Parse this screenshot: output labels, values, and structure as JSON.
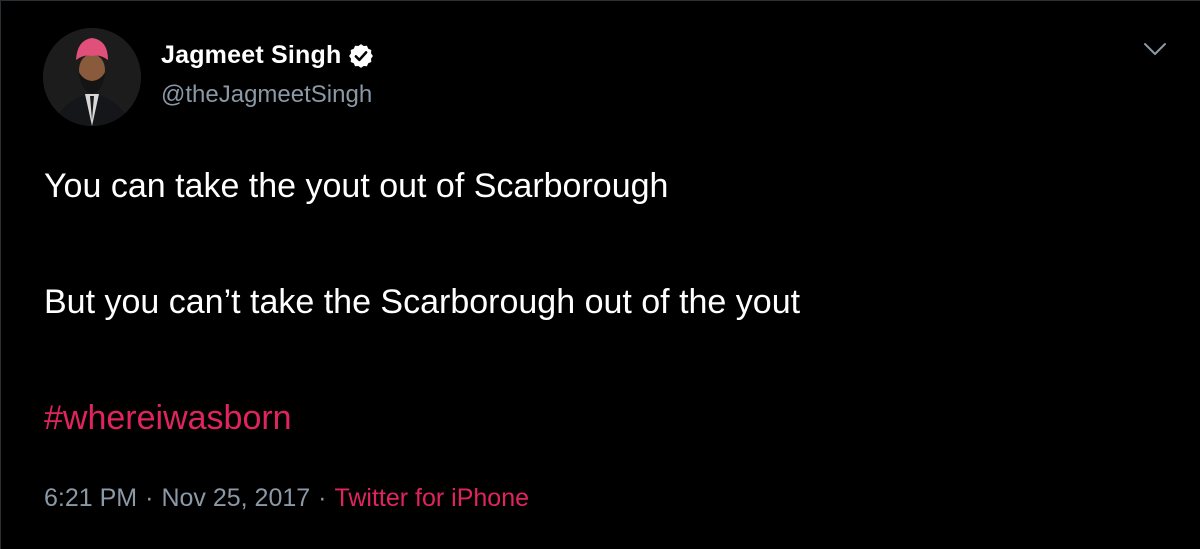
{
  "author": {
    "display_name": "Jagmeet Singh",
    "handle": "@theJagmeetSingh",
    "verified": true
  },
  "tweet": {
    "line1": "You can take the yout out of Scarborough",
    "line2": "But you can’t take the Scarborough out of the yout",
    "hashtag": "#whereiwasborn"
  },
  "meta": {
    "time": "6:21 PM",
    "separator": "·",
    "date": "Nov 25, 2017",
    "source": "Twitter for iPhone"
  },
  "icons": {
    "verified": "verified-badge-icon",
    "menu": "chevron-down-icon"
  },
  "colors": {
    "background": "#000000",
    "text": "#ffffff",
    "secondary": "#8b98a5",
    "accent": "#e0245e"
  }
}
